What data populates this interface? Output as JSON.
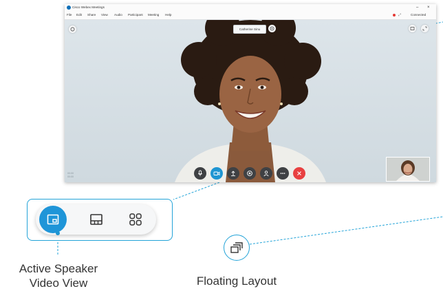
{
  "window": {
    "title": "Cisco Webex Meetings",
    "controls": {
      "minimize": "–",
      "close": "×"
    },
    "menu": [
      "File",
      "Edit",
      "Share",
      "View",
      "Audio",
      "Participant",
      "Meeting",
      "Help"
    ],
    "connection_status": "Connected"
  },
  "meeting": {
    "active_speaker_name": "Catherine Sinu",
    "faint_text": [
      "00:00",
      "00:00"
    ]
  },
  "controls": [
    {
      "name": "mute-button",
      "icon": "microphone-icon"
    },
    {
      "name": "video-button",
      "icon": "camera-icon"
    },
    {
      "name": "share-button",
      "icon": "share-icon"
    },
    {
      "name": "record-button",
      "icon": "record-icon"
    },
    {
      "name": "participants-button",
      "icon": "people-icon"
    },
    {
      "name": "more-button",
      "icon": "more-icon"
    },
    {
      "name": "end-meeting-button",
      "icon": "close-icon"
    }
  ],
  "layout_options": [
    {
      "name": "active-speaker",
      "selected": true,
      "icon": "active-speaker-icon"
    },
    {
      "name": "stack",
      "selected": false,
      "icon": "stack-layout-icon"
    },
    {
      "name": "grid",
      "selected": false,
      "icon": "grid-icon"
    }
  ],
  "captions": {
    "active_speaker_line1": "Active Speaker",
    "active_speaker_line2": "Video View",
    "floating_layout": "Floating Layout"
  },
  "colors": {
    "accent": "#1e95d2",
    "callout_line": "#22a3d8",
    "end_button": "#e84040",
    "control_dark": "#3f4144"
  }
}
